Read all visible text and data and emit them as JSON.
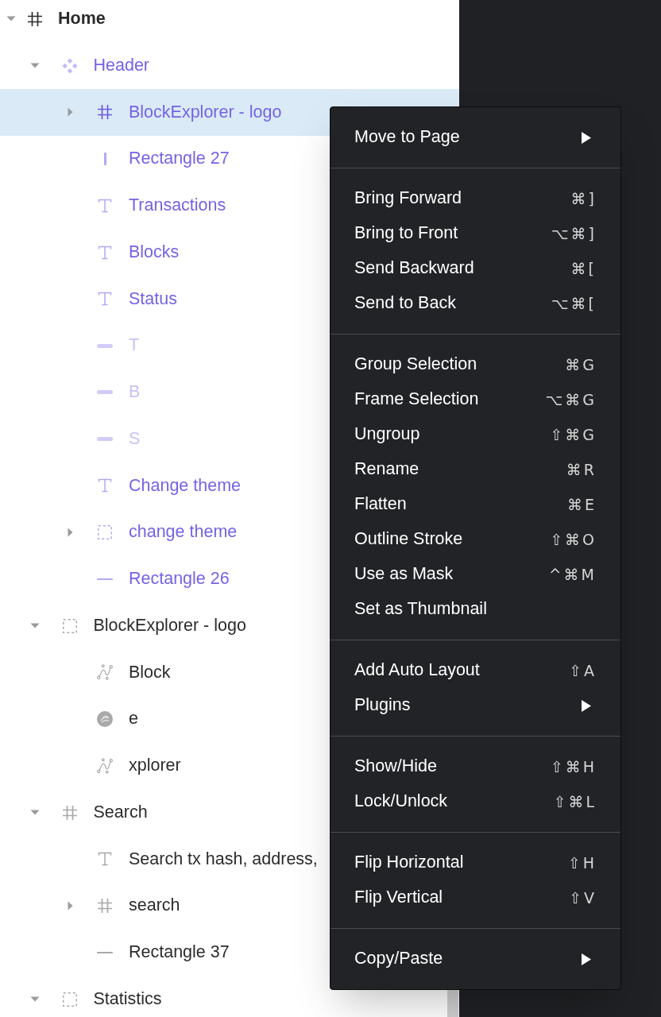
{
  "layers_panel": {
    "layers": [
      {
        "name": "Home",
        "kind": "frame",
        "expanded": true,
        "selected": false,
        "hidden": false,
        "children": [
          {
            "name": "Header",
            "kind": "component",
            "expanded": true,
            "selected": false,
            "hidden": false,
            "children": [
              {
                "name": "BlockExplorer - logo",
                "kind": "frame",
                "expanded": false,
                "selected": true,
                "hidden": false
              },
              {
                "name": "Rectangle 27",
                "kind": "line_v",
                "selected": false,
                "hidden": false
              },
              {
                "name": "Transactions",
                "kind": "text",
                "selected": false,
                "hidden": false
              },
              {
                "name": "Blocks",
                "kind": "text",
                "selected": false,
                "hidden": false
              },
              {
                "name": "Status",
                "kind": "text",
                "selected": false,
                "hidden": false
              },
              {
                "name": "T",
                "kind": "bar",
                "selected": false,
                "hidden": true
              },
              {
                "name": "B",
                "kind": "bar",
                "selected": false,
                "hidden": true
              },
              {
                "name": "S",
                "kind": "bar",
                "selected": false,
                "hidden": true
              },
              {
                "name": "Change theme",
                "kind": "text",
                "selected": false,
                "hidden": false
              },
              {
                "name": "change theme",
                "kind": "group",
                "expanded": false,
                "selected": false,
                "hidden": false
              },
              {
                "name": "Rectangle 26",
                "kind": "line_h",
                "selected": false,
                "hidden": false
              }
            ]
          },
          {
            "name": "BlockExplorer - logo",
            "kind": "group",
            "expanded": true,
            "selected": false,
            "hidden": false,
            "children": [
              {
                "name": "Block",
                "kind": "vector",
                "selected": false,
                "hidden": false
              },
              {
                "name": "e",
                "kind": "image",
                "selected": false,
                "hidden": false
              },
              {
                "name": "xplorer",
                "kind": "vector",
                "selected": false,
                "hidden": false
              }
            ]
          },
          {
            "name": "Search",
            "kind": "frame",
            "expanded": true,
            "selected": false,
            "hidden": false,
            "children": [
              {
                "name": "Search tx hash, address,",
                "kind": "text",
                "selected": false,
                "hidden": false
              },
              {
                "name": "search",
                "kind": "frame",
                "expanded": false,
                "selected": false,
                "hidden": false
              },
              {
                "name": "Rectangle 37",
                "kind": "line_h",
                "selected": false,
                "hidden": false
              }
            ]
          },
          {
            "name": "Statistics",
            "kind": "group",
            "expanded": true,
            "selected": false,
            "hidden": false
          }
        ]
      }
    ]
  },
  "context_menu": {
    "sections": [
      {
        "items": [
          {
            "label": "Move to Page",
            "submenu": true
          }
        ]
      },
      {
        "items": [
          {
            "label": "Bring Forward",
            "shortcut": "⌘]"
          },
          {
            "label": "Bring to Front",
            "shortcut": "⌥⌘]"
          },
          {
            "label": "Send Backward",
            "shortcut": "⌘["
          },
          {
            "label": "Send to Back",
            "shortcut": "⌥⌘["
          }
        ]
      },
      {
        "items": [
          {
            "label": "Group Selection",
            "shortcut": "⌘G"
          },
          {
            "label": "Frame Selection",
            "shortcut": "⌥⌘G"
          },
          {
            "label": "Ungroup",
            "shortcut": "⇧⌘G"
          },
          {
            "label": "Rename",
            "shortcut": "⌘R"
          },
          {
            "label": "Flatten",
            "shortcut": "⌘E"
          },
          {
            "label": "Outline Stroke",
            "shortcut": "⇧⌘O"
          },
          {
            "label": "Use as Mask",
            "shortcut": "^⌘M"
          },
          {
            "label": "Set as Thumbnail"
          }
        ]
      },
      {
        "items": [
          {
            "label": "Add Auto Layout",
            "shortcut": "⇧A"
          },
          {
            "label": "Plugins",
            "submenu": true
          }
        ]
      },
      {
        "items": [
          {
            "label": "Show/Hide",
            "shortcut": "⇧⌘H"
          },
          {
            "label": "Lock/Unlock",
            "shortcut": "⇧⌘L"
          }
        ]
      },
      {
        "items": [
          {
            "label": "Flip Horizontal",
            "shortcut": "⇧H"
          },
          {
            "label": "Flip Vertical",
            "shortcut": "⇧V"
          }
        ]
      },
      {
        "items": [
          {
            "label": "Copy/Paste",
            "submenu": true
          }
        ]
      }
    ]
  }
}
